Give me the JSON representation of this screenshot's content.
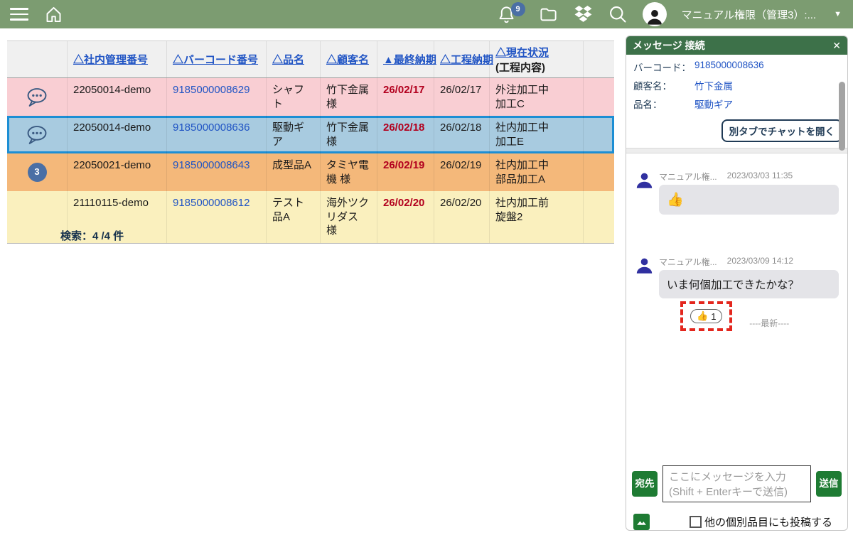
{
  "topbar": {
    "notification_count": "9",
    "user_label": "マニュアル権限（管理3）:..."
  },
  "table": {
    "headers": [
      "△社内管理番号",
      "△バーコード番号",
      "△品名",
      "△顧客名",
      "▲最終納期",
      "△工程納期",
      "△現在状況"
    ],
    "header_sub": "(工程内容)",
    "rows": [
      {
        "icon": "chat-bubble",
        "kanri": "22050014-demo",
        "barcode": "9185000008629",
        "hinmei": "シャフト",
        "kokyaku": "竹下金属 様",
        "saishu": "26/02/17",
        "kotei": "26/02/17",
        "joukyou": "外注加工中\n加工C"
      },
      {
        "icon": "chat-bubble",
        "kanri": "22050014-demo",
        "barcode": "9185000008636",
        "hinmei": "駆動ギア",
        "kokyaku": "竹下金属 様",
        "saishu": "26/02/18",
        "kotei": "26/02/18",
        "joukyou": "社内加工中\n加工E"
      },
      {
        "icon": "count-badge",
        "badge": "3",
        "kanri": "22050021-demo",
        "barcode": "9185000008643",
        "hinmei": "成型品A",
        "kokyaku": "タミヤ電機 様",
        "saishu": "26/02/19",
        "kotei": "26/02/19",
        "joukyou": "社内加工中\n部品加工A"
      },
      {
        "icon": "none",
        "kanri": "21110115-demo",
        "barcode": "9185000008612",
        "hinmei": "テスト品A",
        "kokyaku": "海外ツクリダス 様",
        "saishu": "26/02/20",
        "kotei": "26/02/20",
        "joukyou": "社内加工前\n旋盤2"
      }
    ],
    "search_summary": "検索：4 /4 件"
  },
  "chat": {
    "title": "メッセージ 接続",
    "close_label": "✕",
    "info": {
      "barcode_label": "バーコード：",
      "barcode_value": "9185000008636",
      "customer_label": "顧客名：",
      "customer_value": "竹下金属",
      "item_label": "品名：",
      "item_value": "駆動ギア"
    },
    "open_tab_button": "別タブでチャットを開く",
    "messages": [
      {
        "name": "マニュアル権...",
        "time": "2023/03/03 11:35",
        "text": "👍"
      },
      {
        "name": "マニュアル権...",
        "time": "2023/03/09 14:12",
        "text": "いま何個加工できたかな？",
        "reaction_emoji": "👍",
        "reaction_count": "1"
      }
    ],
    "latest_marker": "----最新----",
    "composer": {
      "to_button": "宛先",
      "placeholder": "ここにメッセージを入力\n(Shift + Enterキーで送信)",
      "send_button": "送信",
      "checkbox_label": "他の個別品目にも投稿する"
    }
  },
  "icons": {
    "topbar": [
      "menu-icon",
      "home-icon",
      "bell-icon",
      "folder-icon",
      "dropbox-icon",
      "search-icon",
      "avatar-icon",
      "chevron-down-icon"
    ],
    "table": [
      "chat-bubble-icon"
    ],
    "panel": [
      "close-icon",
      "person-avatar-icon",
      "image-icon"
    ]
  },
  "colors": {
    "topbar_bg": "#7c9c71",
    "panel_header_bg": "#3d7149",
    "button_green": "#1e7b33",
    "link_blue": "#2054c4",
    "overdue_red": "#b2001e",
    "row_pink": "#f9ced3",
    "row_selected_bg": "#a8cbe0",
    "row_selected_border": "#1c8ed4",
    "row_orange": "#f4b87a",
    "row_yellow": "#faf0be",
    "notification_badge_blue": "#4a6fa5",
    "highlight_dashed_red": "#e3261d"
  }
}
